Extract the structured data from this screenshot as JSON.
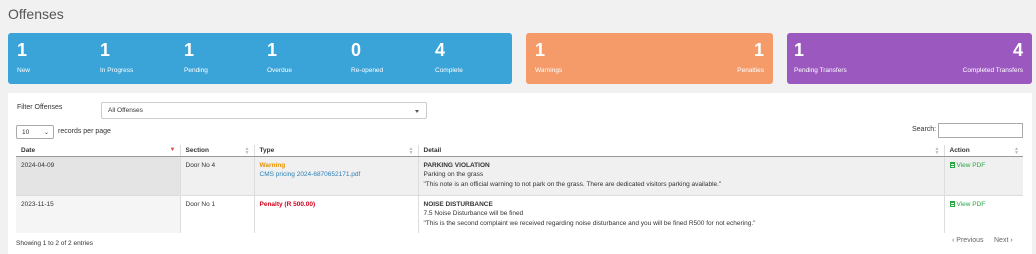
{
  "page": {
    "title": "Offenses"
  },
  "stats_blue": [
    {
      "value": "1",
      "label": "New"
    },
    {
      "value": "1",
      "label": "In Progress"
    },
    {
      "value": "1",
      "label": "Pending"
    },
    {
      "value": "1",
      "label": "Overdue"
    },
    {
      "value": "0",
      "label": "Re-opened"
    },
    {
      "value": "4",
      "label": "Complete"
    }
  ],
  "stats_orange": [
    {
      "value": "1",
      "label": "Warnings"
    },
    {
      "value": "1",
      "label": "Penalties"
    }
  ],
  "stats_purple": [
    {
      "value": "1",
      "label": "Pending Transfers"
    },
    {
      "value": "4",
      "label": "Completed Transfers"
    }
  ],
  "colors": {
    "blue": "#3aa3d8",
    "orange": "#f59b6a",
    "purple": "#9b59c0",
    "warning": "#e69500",
    "penalty": "#d0021b",
    "pdf_link": "#28a745",
    "file_link": "#2a7fb8"
  },
  "filter": {
    "label": "Filter Offenses",
    "selected": "All Offenses"
  },
  "table_controls": {
    "page_length": "10",
    "page_length_label": "records per page",
    "search_label": "Search:",
    "search_value": ""
  },
  "columns": [
    "Date",
    "Section",
    "Type",
    "Detail",
    "Action"
  ],
  "rows": [
    {
      "date": "2024-04-09",
      "section": "Door No 4",
      "type": "Warning",
      "attachment": "CMS pricing 2024-6870652171.pdf",
      "detail_title": "PARKING VIOLATION",
      "detail_subtitle": "Parking on the grass",
      "detail_note": "\"This note is an official warning to not park on the grass. There are dedicated visitors parking available.\"",
      "action": "View PDF"
    },
    {
      "date": "2023-11-15",
      "section": "Door No 1",
      "type": "Penalty (R 500.00)",
      "attachment": "",
      "detail_title": "NOISE DISTURBANCE",
      "detail_subtitle": "7.5 Noise Disturbance will be fined",
      "detail_note": "\"This is the second complaint we received regarding noise disturbance and you will be fined R500 for not echering.\"",
      "action": "View PDF"
    }
  ],
  "footer": {
    "info": "Showing 1 to 2 of 2 entries",
    "previous": "Previous",
    "next": "Next"
  },
  "icons": {
    "sort": "sort-arrows-icon",
    "sort_active": "sort-desc-icon",
    "pdf": "pdf-file-icon",
    "pager_prev": "chevron-left-icon",
    "pager_next": "chevron-right-icon",
    "select_caret": "caret-down-icon"
  }
}
